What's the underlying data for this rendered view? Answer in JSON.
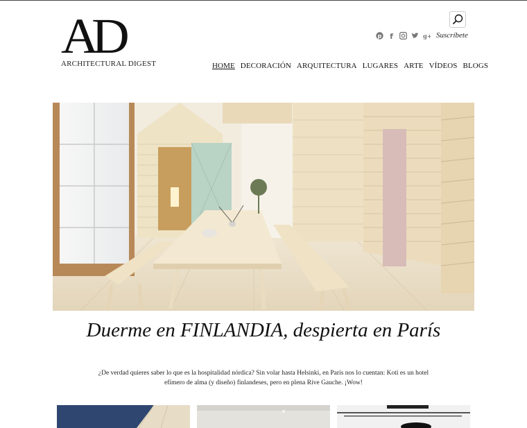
{
  "brand": {
    "logo": "AD",
    "name": "ARCHITECTURAL DIGEST"
  },
  "header": {
    "search_icon": "search-icon",
    "social": [
      "pinterest-icon",
      "facebook-icon",
      "instagram-icon",
      "twitter-icon",
      "googleplus-icon"
    ],
    "subscribe_label": "Suscríbete"
  },
  "nav": {
    "items": [
      {
        "label": "HOME",
        "active": true
      },
      {
        "label": "DECORACIÓN"
      },
      {
        "label": "ARQUITECTURA"
      },
      {
        "label": "LUGARES"
      },
      {
        "label": "ARTE"
      },
      {
        "label": "VÍDEOS"
      },
      {
        "label": "BLOGS"
      }
    ]
  },
  "article": {
    "headline": "Duerme en FINLANDIA, despierta en París",
    "dek": "¿De verdad quieres saber lo que es la hospitalidad nórdica? Sin volar hasta Helsinki, en París nos lo cuentan: Koti es un hotel efímero de alma (y diseño) finlandeses, pero en plena Rive Gauche. ¡Wow!"
  },
  "colors": {
    "wood": "#efe4cc",
    "floor": "#e8dcc2",
    "mint_door": "#b9d3c4",
    "pink_door": "#d8bcb8",
    "text": "#111111"
  }
}
